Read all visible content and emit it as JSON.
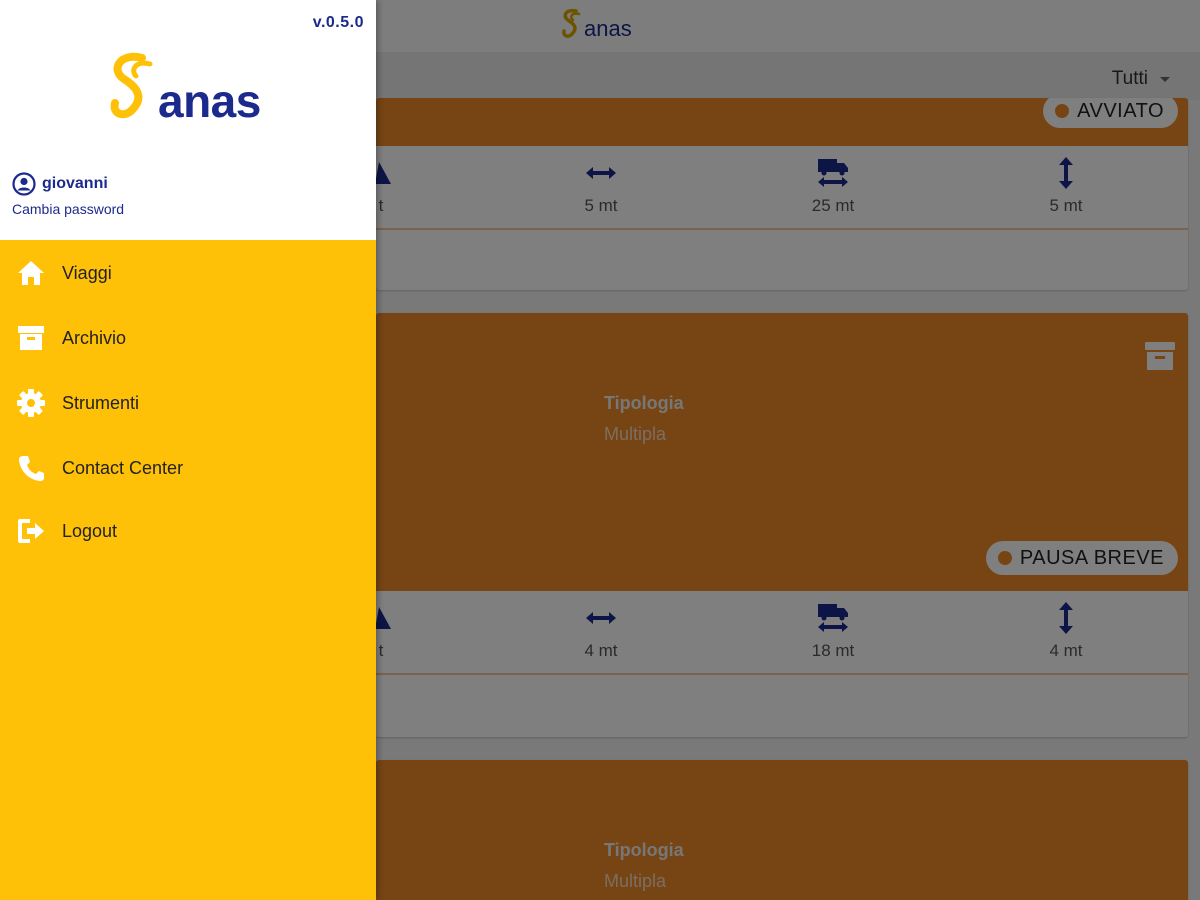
{
  "header": {
    "logo_text": "anas"
  },
  "filter": {
    "selected": "Tutti"
  },
  "cards": [
    {
      "status": "AVVIATO",
      "dims": [
        {
          "icon": "weight-icon",
          "value": "t"
        },
        {
          "icon": "width-arrow-icon",
          "value": "5 mt"
        },
        {
          "icon": "truck-length-icon",
          "value": "25 mt"
        },
        {
          "icon": "height-arrow-icon",
          "value": "5 mt"
        }
      ]
    },
    {
      "tipologia_label": "Tipologia",
      "tipologia_value": "Multipla",
      "status": "PAUSA BREVE",
      "dims": [
        {
          "icon": "weight-icon",
          "value": "t"
        },
        {
          "icon": "width-arrow-icon",
          "value": "4 mt"
        },
        {
          "icon": "truck-length-icon",
          "value": "18 mt"
        },
        {
          "icon": "height-arrow-icon",
          "value": "4 mt"
        }
      ]
    },
    {
      "tipologia_label": "Tipologia",
      "tipologia_value": "Multipla"
    }
  ],
  "drawer": {
    "version": "v.0.5.0",
    "brand": "anas",
    "username": "giovanni",
    "change_password": "Cambia password",
    "menu": [
      {
        "icon": "home-icon",
        "label": "Viaggi"
      },
      {
        "icon": "archive-icon",
        "label": "Archivio"
      },
      {
        "icon": "gear-icon",
        "label": "Strumenti"
      },
      {
        "icon": "phone-icon",
        "label": "Contact Center"
      },
      {
        "icon": "logout-icon",
        "label": "Logout"
      }
    ]
  },
  "colors": {
    "brand_blue": "#1b2a8c",
    "brand_yellow": "#ffc107",
    "status_orange": "#ef8a28"
  }
}
